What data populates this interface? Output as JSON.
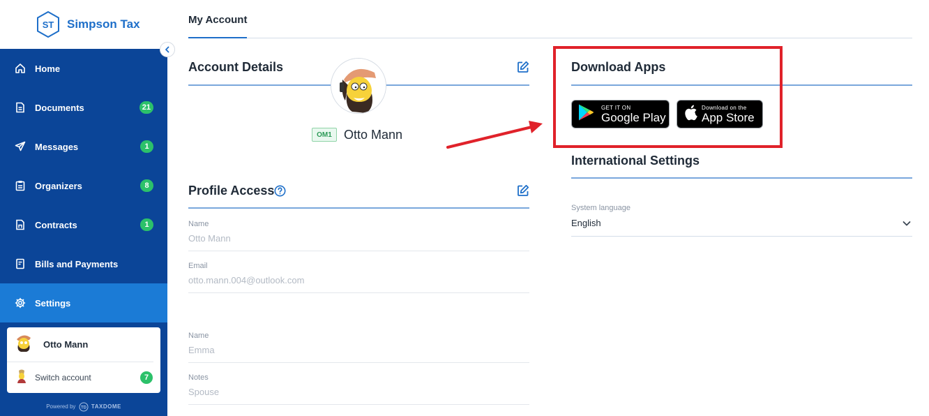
{
  "brand": {
    "initials": "ST",
    "name": "Simpson Tax"
  },
  "nav": [
    {
      "label": "Home",
      "badge": ""
    },
    {
      "label": "Documents",
      "badge": "21"
    },
    {
      "label": "Messages",
      "badge": "1"
    },
    {
      "label": "Organizers",
      "badge": "8"
    },
    {
      "label": "Contracts",
      "badge": "1"
    },
    {
      "label": "Bills and Payments",
      "badge": ""
    },
    {
      "label": "Settings",
      "badge": ""
    }
  ],
  "user_card": {
    "name": "Otto Mann",
    "switch_label": "Switch account",
    "switch_badge": "7"
  },
  "powered_by": {
    "prefix": "Powered by",
    "logo_mark": "TD",
    "brand": "TAXDOME"
  },
  "tab": {
    "label": "My Account"
  },
  "account_details": {
    "title": "Account Details",
    "client_code": "OM1",
    "client_name": "Otto Mann"
  },
  "profile_access": {
    "title": "Profile Access",
    "fields": [
      {
        "label": "Name",
        "value": "Otto Mann"
      },
      {
        "label": "Email",
        "value": "otto.mann.004@outlook.com"
      },
      {
        "label": "Name",
        "value": "Emma"
      },
      {
        "label": "Notes",
        "value": "Spouse"
      }
    ]
  },
  "download_apps": {
    "title": "Download Apps",
    "google_play": {
      "small": "GET IT ON",
      "big": "Google Play"
    },
    "app_store": {
      "small": "Download on the",
      "big": "App Store"
    }
  },
  "international": {
    "title": "International Settings",
    "language_label": "System language",
    "language_value": "English"
  },
  "colors": {
    "sidebar": "#0b4598",
    "active": "#1b7bd6",
    "badge": "#2cc16a",
    "accent": "#1e6fc9",
    "annotation": "#e0222a"
  }
}
